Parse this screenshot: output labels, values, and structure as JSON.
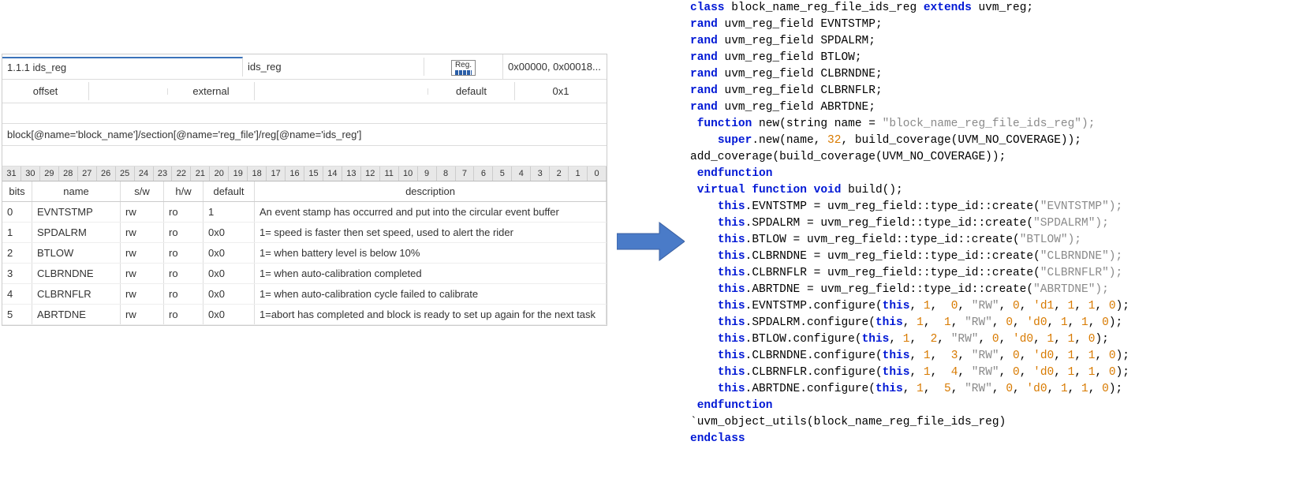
{
  "left": {
    "section_no": "1.1.1 ids_reg",
    "reg_name": "ids_reg",
    "reg_badge": "Reg.",
    "addr_text": "0x00000, 0x00018...",
    "offset_label": "offset",
    "external_label": "external",
    "default_label": "default",
    "default_value_top": "0x1",
    "xpath": "block[@name='block_name']/section[@name='reg_file']/reg[@name='ids_reg']",
    "bit_indices": [
      "31",
      "30",
      "29",
      "28",
      "27",
      "26",
      "25",
      "24",
      "23",
      "22",
      "21",
      "20",
      "19",
      "18",
      "17",
      "16",
      "15",
      "14",
      "13",
      "12",
      "11",
      "10",
      "9",
      "8",
      "7",
      "6",
      "5",
      "4",
      "3",
      "2",
      "1",
      "0"
    ],
    "columns": {
      "bits": "bits",
      "name": "name",
      "sw": "s/w",
      "hw": "h/w",
      "def": "default",
      "desc": "description"
    },
    "fields": [
      {
        "bit": "0",
        "name": "EVNTSTMP",
        "sw": "rw",
        "hw": "ro",
        "def": "1",
        "desc": "An event stamp has occurred and put into the circular event buffer"
      },
      {
        "bit": "1",
        "name": "SPDALRM",
        "sw": "rw",
        "hw": "ro",
        "def": "0x0",
        "desc": "1= speed is faster then set speed, used to alert the rider"
      },
      {
        "bit": "2",
        "name": "BTLOW",
        "sw": "rw",
        "hw": "ro",
        "def": "0x0",
        "desc": "1= when battery level is below 10%"
      },
      {
        "bit": "3",
        "name": "CLBRNDNE",
        "sw": "rw",
        "hw": "ro",
        "def": "0x0",
        "desc": "1= when auto-calibration completed"
      },
      {
        "bit": "4",
        "name": "CLBRNFLR",
        "sw": "rw",
        "hw": "ro",
        "def": "0x0",
        "desc": "1= when auto-calibration cycle failed to calibrate"
      },
      {
        "bit": "5",
        "name": "ABRTDNE",
        "sw": "rw",
        "hw": "ro",
        "def": "0x0",
        "desc": "1=abort has completed and block is ready to set up again for the next task"
      }
    ]
  },
  "code": {
    "class_name": "block_name_reg_file_ids_reg",
    "base_class": "uvm_reg;",
    "field_type": "uvm_reg_field",
    "rand_fields": [
      "EVNTSTMP;",
      "SPDALRM;",
      "BTLOW;",
      "CLBRNDNE;",
      "CLBRNFLR;",
      "ABRTDNE;"
    ],
    "func_new_sig": "new(string name = ",
    "func_new_arg": "\"block_name_reg_file_ids_reg\");",
    "super_new_pre": ".new(name, ",
    "super_new_num": "32",
    "super_new_post": ", build_coverage(UVM_NO_COVERAGE));",
    "add_cov": "add_coverage(build_coverage(UVM_NO_COVERAGE));",
    "endfunction": "endfunction",
    "build_sig": "build();",
    "creates": [
      {
        "lhs": ".EVNTSTMP = uvm_reg_field::type_id::create(",
        "arg": "\"EVNTSTMP\");"
      },
      {
        "lhs": ".SPDALRM = uvm_reg_field::type_id::create(",
        "arg": "\"SPDALRM\");"
      },
      {
        "lhs": ".BTLOW = uvm_reg_field::type_id::create(",
        "arg": "\"BTLOW\");"
      },
      {
        "lhs": ".CLBRNDNE = uvm_reg_field::type_id::create(",
        "arg": "\"CLBRNDNE\");"
      },
      {
        "lhs": ".CLBRNFLR = uvm_reg_field::type_id::create(",
        "arg": "\"CLBRNFLR\");"
      },
      {
        "lhs": ".ABRTDNE = uvm_reg_field::type_id::create(",
        "arg": "\"ABRTDNE\");"
      }
    ],
    "configures": [
      {
        "name": ".EVNTSTMP.configure(",
        "args_pre": ", ",
        "n1": "1",
        "s1": ",  ",
        "n2": "0",
        "s2": ", ",
        "rw": "\"RW\"",
        "s3": ", ",
        "n3": "0",
        "s4": ", ",
        "d": "'d1",
        "s5": ", ",
        "t1": "1",
        "s6": ", ",
        "t2": "1",
        "s7": ", ",
        "t3": "0",
        "end": ");"
      },
      {
        "name": ".SPDALRM.configure(",
        "args_pre": ", ",
        "n1": "1",
        "s1": ",  ",
        "n2": "1",
        "s2": ", ",
        "rw": "\"RW\"",
        "s3": ", ",
        "n3": "0",
        "s4": ", ",
        "d": "'d0",
        "s5": ", ",
        "t1": "1",
        "s6": ", ",
        "t2": "1",
        "s7": ", ",
        "t3": "0",
        "end": ");"
      },
      {
        "name": ".BTLOW.configure(",
        "args_pre": ", ",
        "n1": "1",
        "s1": ",  ",
        "n2": "2",
        "s2": ", ",
        "rw": "\"RW\"",
        "s3": ", ",
        "n3": "0",
        "s4": ", ",
        "d": "'d0",
        "s5": ", ",
        "t1": "1",
        "s6": ", ",
        "t2": "1",
        "s7": ", ",
        "t3": "0",
        "end": ");"
      },
      {
        "name": ".CLBRNDNE.configure(",
        "args_pre": ", ",
        "n1": "1",
        "s1": ",  ",
        "n2": "3",
        "s2": ", ",
        "rw": "\"RW\"",
        "s3": ", ",
        "n3": "0",
        "s4": ", ",
        "d": "'d0",
        "s5": ", ",
        "t1": "1",
        "s6": ", ",
        "t2": "1",
        "s7": ", ",
        "t3": "0",
        "end": ");"
      },
      {
        "name": ".CLBRNFLR.configure(",
        "args_pre": ", ",
        "n1": "1",
        "s1": ",  ",
        "n2": "4",
        "s2": ", ",
        "rw": "\"RW\"",
        "s3": ", ",
        "n3": "0",
        "s4": ", ",
        "d": "'d0",
        "s5": ", ",
        "t1": "1",
        "s6": ", ",
        "t2": "1",
        "s7": ", ",
        "t3": "0",
        "end": ");"
      },
      {
        "name": ".ABRTDNE.configure(",
        "args_pre": ", ",
        "n1": "1",
        "s1": ",  ",
        "n2": "5",
        "s2": ", ",
        "rw": "\"RW\"",
        "s3": ", ",
        "n3": "0",
        "s4": ", ",
        "d": "'d0",
        "s5": ", ",
        "t1": "1",
        "s6": ", ",
        "t2": "1",
        "s7": ", ",
        "t3": "0",
        "end": ");"
      }
    ],
    "uvm_macro_pre": "`uvm_object_utils(",
    "uvm_macro_arg": "block_name_reg_file_ids_reg)",
    "endclass": "endclass",
    "kw_class": "class",
    "kw_extends": "extends",
    "kw_rand": "rand",
    "kw_function": "function",
    "kw_super": "super",
    "kw_virtual": "virtual function void",
    "kw_this": "this"
  }
}
